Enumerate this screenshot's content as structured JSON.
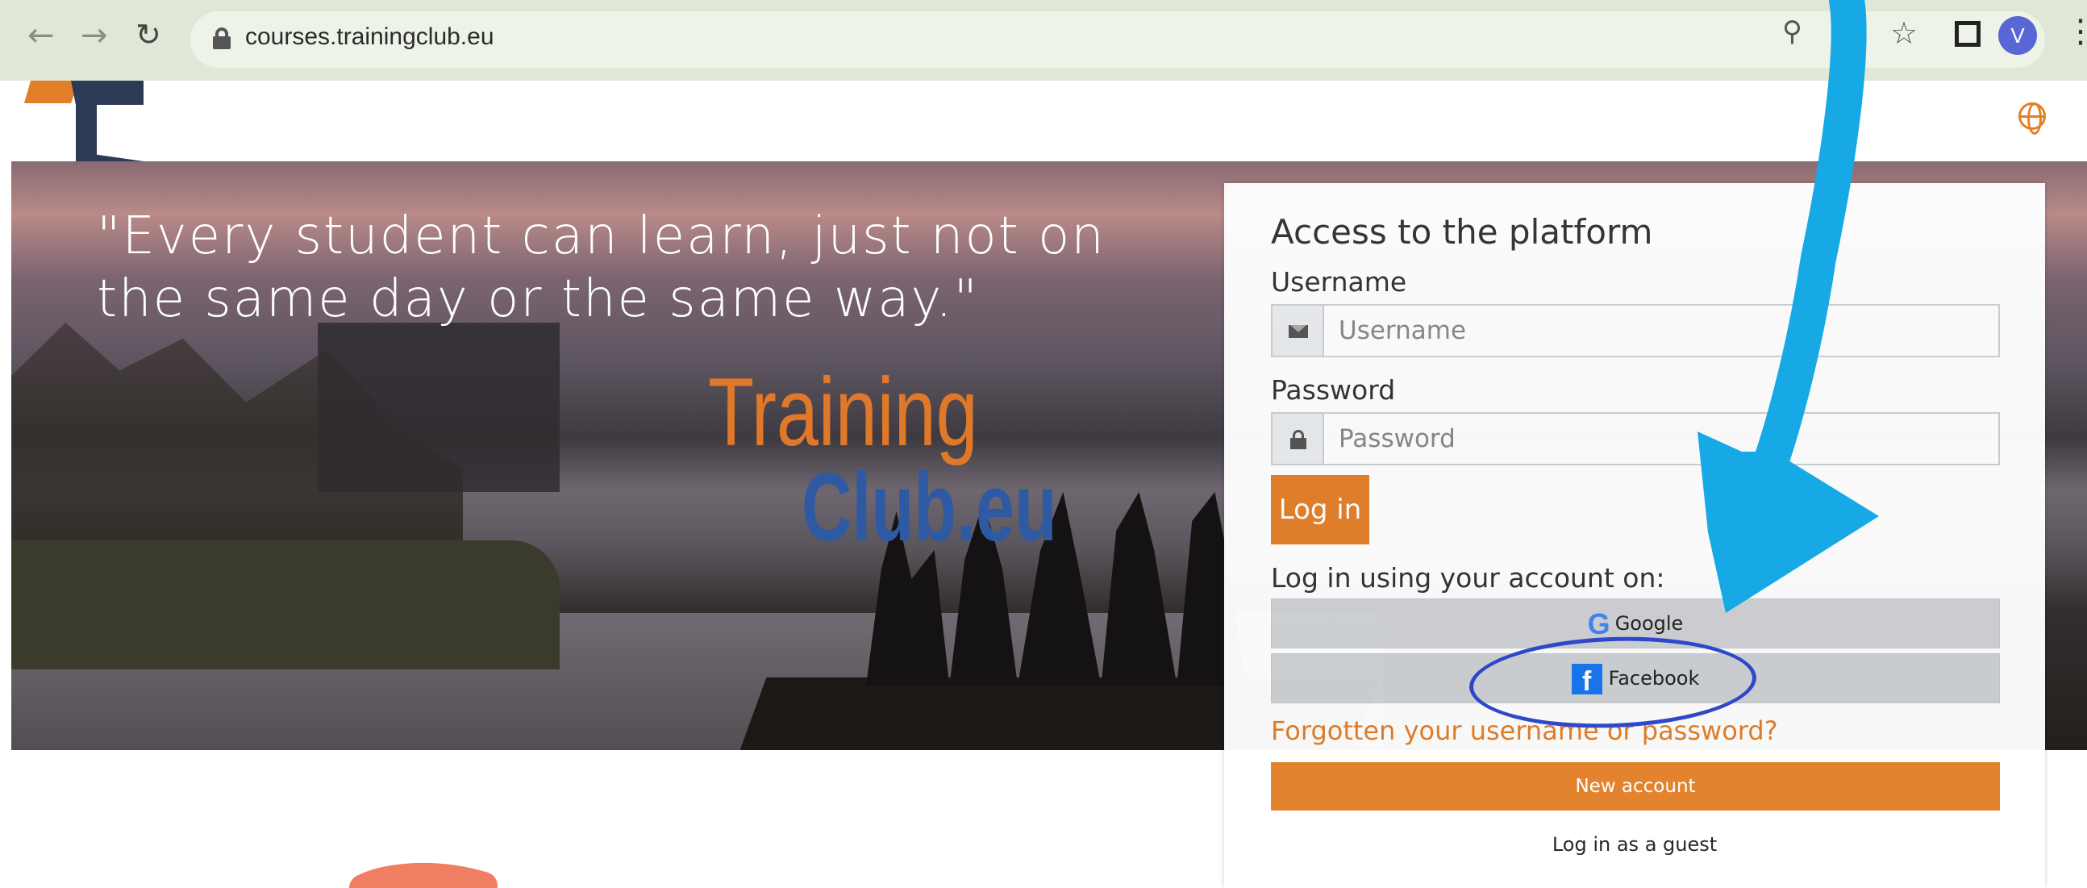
{
  "browser": {
    "url": "courses.trainingclub.eu",
    "profile_initial": "V",
    "icons": [
      "back-icon",
      "forward-icon",
      "reload-icon",
      "lock-icon",
      "zoom-icon",
      "share-icon",
      "star-icon",
      "side-panel-icon",
      "profile-avatar",
      "more-icon"
    ]
  },
  "site": {
    "logo_name": "trainingclub-logo-icon",
    "language_icon": "globe-icon"
  },
  "hero": {
    "quote_line1": "\"Every student can learn, just not on",
    "quote_line2": "the same day or the same way.\"",
    "brand_line1": "Training",
    "brand_line2": "Club.eu"
  },
  "login": {
    "title": "Access to the platform",
    "username_label": "Username",
    "username_placeholder": "Username",
    "password_label": "Password",
    "password_placeholder": "Password",
    "login_button": "Log in",
    "oauth_label": "Log in using your account on:",
    "google_button": "Google",
    "facebook_button": "Facebook",
    "forgot_link": "Forgotten your username or password?",
    "new_account_button": "New account",
    "guest_link": "Log in as a guest"
  },
  "colors": {
    "accent_orange": "#e37f28",
    "annotation_blue": "#17a9e6",
    "highlight_ellipse": "#2e48c9",
    "annotation_salmon": "#f07e63"
  }
}
